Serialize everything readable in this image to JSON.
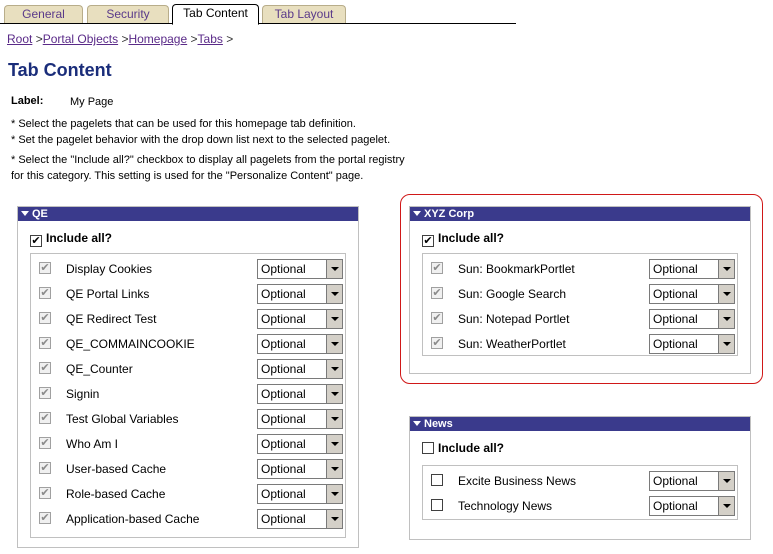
{
  "tabs": [
    {
      "label": "General"
    },
    {
      "label": "Security"
    },
    {
      "label": "Tab Content"
    },
    {
      "label": "Tab Layout"
    }
  ],
  "breadcrumb": {
    "items": [
      "Root",
      "Portal Objects",
      "Homepage",
      "Tabs"
    ],
    "separator": ">"
  },
  "page": {
    "title": "Tab Content",
    "label_key": "Label:",
    "label_value": "My Page"
  },
  "instructions": [
    "* Select the pagelets that can be used for this homepage tab definition.",
    "* Set the pagelet behavior with the drop down list next to the selected pagelet.",
    "* Select the \"Include all?\" checkbox to display all pagelets from the portal registry",
    "for this category. This setting is used for the \"Personalize Content\" page."
  ],
  "include_all_label": "Include all?",
  "groups": {
    "qe": {
      "title": "QE",
      "include_all": true,
      "items": [
        {
          "label": "Display Cookies",
          "option": "Optional"
        },
        {
          "label": "QE Portal Links",
          "option": "Optional"
        },
        {
          "label": "QE Redirect Test",
          "option": "Optional"
        },
        {
          "label": "QE_COMMAINCOOKIE",
          "option": "Optional"
        },
        {
          "label": "QE_Counter",
          "option": "Optional"
        },
        {
          "label": "Signin",
          "option": "Optional"
        },
        {
          "label": "Test Global Variables",
          "option": "Optional"
        },
        {
          "label": "Who Am I",
          "option": "Optional"
        },
        {
          "label": "User-based Cache",
          "option": "Optional"
        },
        {
          "label": "Role-based Cache",
          "option": "Optional"
        },
        {
          "label": "Application-based Cache",
          "option": "Optional"
        }
      ]
    },
    "xyz": {
      "title": "XYZ Corp",
      "include_all": true,
      "items": [
        {
          "label": "Sun: BookmarkPortlet",
          "option": "Optional"
        },
        {
          "label": "Sun: Google Search",
          "option": "Optional"
        },
        {
          "label": "Sun: Notepad Portlet",
          "option": "Optional"
        },
        {
          "label": "Sun: WeatherPortlet",
          "option": "Optional"
        }
      ]
    },
    "news": {
      "title": "News",
      "include_all": false,
      "items": [
        {
          "label": "Excite Business News",
          "option": "Optional"
        },
        {
          "label": "Technology News",
          "option": "Optional"
        }
      ]
    }
  },
  "colors": {
    "header_bg": "#3a3a8c",
    "title": "#1a2d7a",
    "link": "#5a2a88",
    "highlight_border": "#d01818",
    "tab_bg": "#e8dfbf"
  }
}
